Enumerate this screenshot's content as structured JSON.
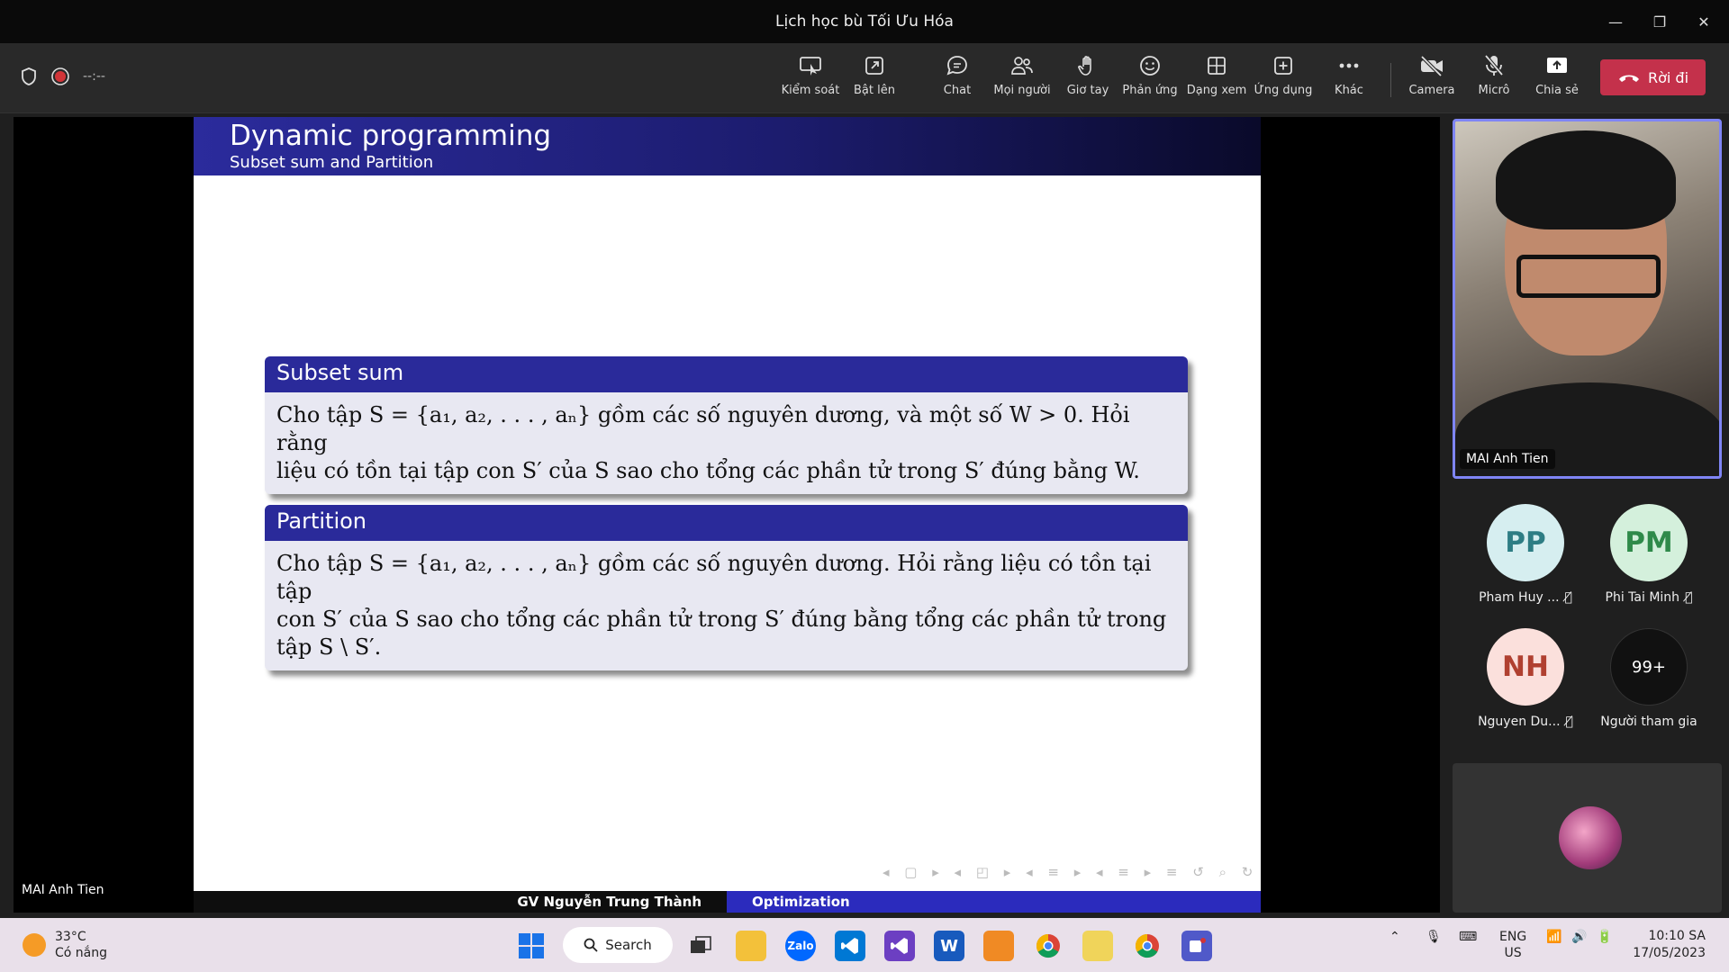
{
  "window": {
    "title": "Lịch học bù Tối Ưu Hóa",
    "minimize": "—",
    "maximize": "❐",
    "close": "✕"
  },
  "toolbar": {
    "timer": "--:--",
    "buttons": [
      {
        "label": "Kiểm soát",
        "icon": "screen-control-icon"
      },
      {
        "label": "Bật lên",
        "icon": "pop-out-icon"
      },
      {
        "label": "Chat",
        "icon": "chat-icon"
      },
      {
        "label": "Mọi người",
        "icon": "people-icon"
      },
      {
        "label": "Giơ tay",
        "icon": "raise-hand-icon"
      },
      {
        "label": "Phản ứng",
        "icon": "reaction-icon"
      },
      {
        "label": "Dạng xem",
        "icon": "view-icon"
      },
      {
        "label": "Ứng dụng",
        "icon": "apps-icon"
      },
      {
        "label": "Khác",
        "icon": "more-icon"
      },
      {
        "label": "Camera",
        "icon": "camera-off-icon"
      },
      {
        "label": "Micrô",
        "icon": "mic-off-icon"
      },
      {
        "label": "Chia sẻ",
        "icon": "share-icon"
      }
    ],
    "leave_label": "Rời đi",
    "accent": "#c4314b"
  },
  "slide": {
    "title": "Dynamic programming",
    "subtitle": "Subset sum and Partition",
    "blocks": [
      {
        "title": "Subset sum",
        "body_line1": "Cho tập S = {a₁, a₂, . . . , aₙ} gồm các số nguyên dương, và một số W > 0. Hỏi rằng",
        "body_line2": "liệu có tồn tại tập con S′ của S sao cho tổng các phần tử trong S′ đúng bằng W."
      },
      {
        "title": "Partition",
        "body_line1": "Cho tập S = {a₁, a₂, . . . , aₙ} gồm các số nguyên dương. Hỏi rằng liệu có tồn tại tập",
        "body_line2": "con S′ của S sao cho tổng các phần tử trong S′ đúng bằng tổng các phần tử trong",
        "body_line3": "tập S \\ S′."
      }
    ],
    "footer_left": "GV Nguyễn Trung Thành",
    "footer_right": "Optimization",
    "nav_symbols": "◂ ▢ ▸ ◂ ◰ ▸ ◂ ≡ ▸ ◂ ≡ ▸ ≡ ↺ ⌕ ↻",
    "header_color": "#2b2b9c"
  },
  "stage_presenter": "MAI Anh Tien",
  "self_view": {
    "name": "MAI Anh Tien",
    "border_color": "#7f85f5"
  },
  "participants": [
    {
      "initials": "PP",
      "name": "Pham Huy ...",
      "muted": true,
      "bg": "#d6eef0",
      "fg": "#2e7d84"
    },
    {
      "initials": "PM",
      "name": "Phi Tai Minh",
      "muted": true,
      "bg": "#d4f0dc",
      "fg": "#2f8a4a"
    },
    {
      "initials": "NH",
      "name": "Nguyen Du...",
      "muted": true,
      "bg": "#fbe0dc",
      "fg": "#b04030"
    },
    {
      "initials": "99+",
      "name": "Người tham gia",
      "muted": false,
      "bg": "#111111",
      "fg": "#ffffff"
    }
  ],
  "taskbar": {
    "temperature": "33°C",
    "weather": "Có nắng",
    "search_label": "Search",
    "apps": [
      "start-icon",
      "task-view-icon",
      "file-explorer-icon",
      "zalo-icon",
      "vscode-icon",
      "visual-studio-icon",
      "word-icon",
      "ggb-icon",
      "chrome-icon",
      "paint-icon",
      "chrome-profile-icon",
      "teams-icon"
    ],
    "zalo_label": "Zalo",
    "word_label": "W",
    "language_line1": "ENG",
    "language_line2": "US",
    "time": "10:10 SA",
    "date": "17/05/2023"
  }
}
